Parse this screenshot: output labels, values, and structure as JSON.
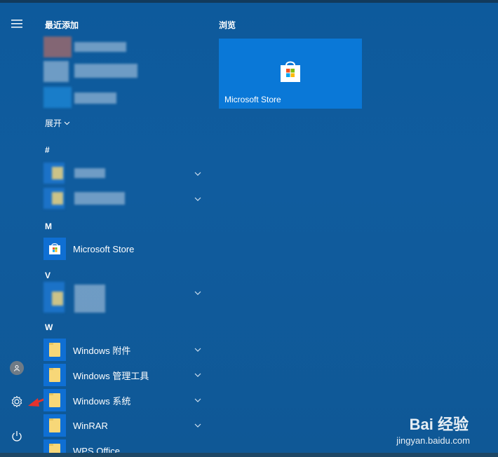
{
  "sections": {
    "recent_title": "最近添加",
    "browse_title": "浏览"
  },
  "expand_label": "展开",
  "letters": {
    "hash": "#",
    "m": "M",
    "v": "V",
    "w": "W"
  },
  "apps": {
    "ms_store": "Microsoft Store",
    "win_accessories": "Windows 附件",
    "win_admin_tools": "Windows 管理工具",
    "win_system": "Windows 系统",
    "winrar": "WinRAR",
    "wps_office": "WPS Office"
  },
  "tiles": {
    "ms_store": "Microsoft Store"
  },
  "watermark": {
    "brand": "Bai 经验",
    "url": "jingyan.baidu.com"
  },
  "rail_icons": [
    "hamburger-icon",
    "avatar",
    "gear-icon",
    "power-icon"
  ],
  "colors": {
    "background": "#105c9e",
    "tile": "#0a78d7",
    "app_tile": "#0f6fd3",
    "folder": "#f7d778",
    "annotation_arrow": "#e5322d"
  }
}
